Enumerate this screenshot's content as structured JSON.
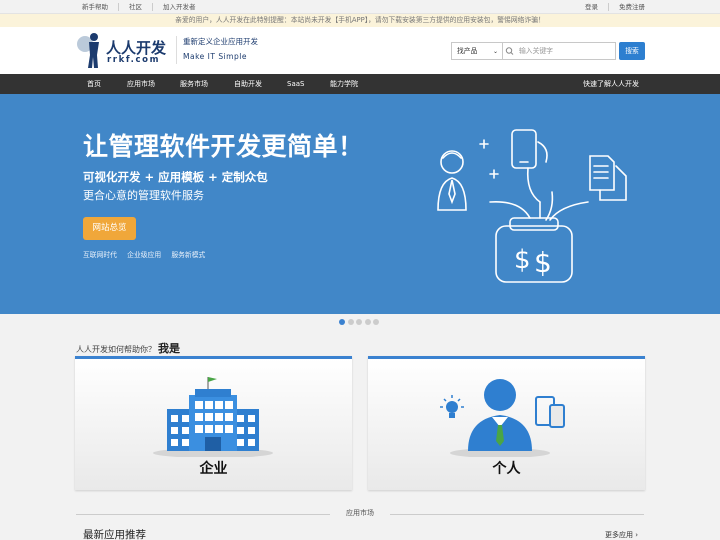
{
  "topbar": {
    "left_links": [
      "新手帮助",
      "社区",
      "加入开发者"
    ],
    "right_links": [
      "登录",
      "免费注册"
    ]
  },
  "notice": "亲爱的用户，人人开发在此特别提醒：本站尚未开发【手机APP】，请勿下载安装第三方提供的应用安装包，警惕网络诈骗！",
  "header": {
    "logo_brand": "人人开发",
    "logo_domain": "rrkf.com",
    "slogan_cn": "重新定义企业应用开发",
    "slogan_en": "Make  IT  Simple",
    "search_category": "找产品",
    "search_placeholder": "输入关键字",
    "search_button": "搜索"
  },
  "nav": {
    "items": [
      "首页",
      "应用市场",
      "服务市场",
      "自助开发",
      "SaaS",
      "能力学院"
    ],
    "right_link": "快速了解人人开发"
  },
  "banner": {
    "headline": "让管理软件开发更简单！",
    "sub1": "可视化开发 + 应用模板 + 定制众包",
    "sub2": "更合心意的管理软件服务",
    "button": "网站总览",
    "tags": [
      "互联网时代",
      "企业级应用",
      "服务新模式"
    ]
  },
  "carousel": {
    "count": 5,
    "active": 1
  },
  "help": {
    "question": "人人开发如何帮助你？",
    "emphasis": "我是",
    "cards": [
      {
        "label": "企业",
        "icon": "enterprise-building-icon"
      },
      {
        "label": "个人",
        "icon": "person-icon"
      }
    ]
  },
  "market": {
    "divider_label": "应用市场",
    "section_title": "最新应用推荐",
    "more_link": "更多应用 ›"
  },
  "colors": {
    "accent": "#3b82d0",
    "banner_bg": "#4187c8",
    "nav_bg": "#333333",
    "cta_orange": "#f0a73a",
    "brand_navy": "#1c3b6e"
  }
}
